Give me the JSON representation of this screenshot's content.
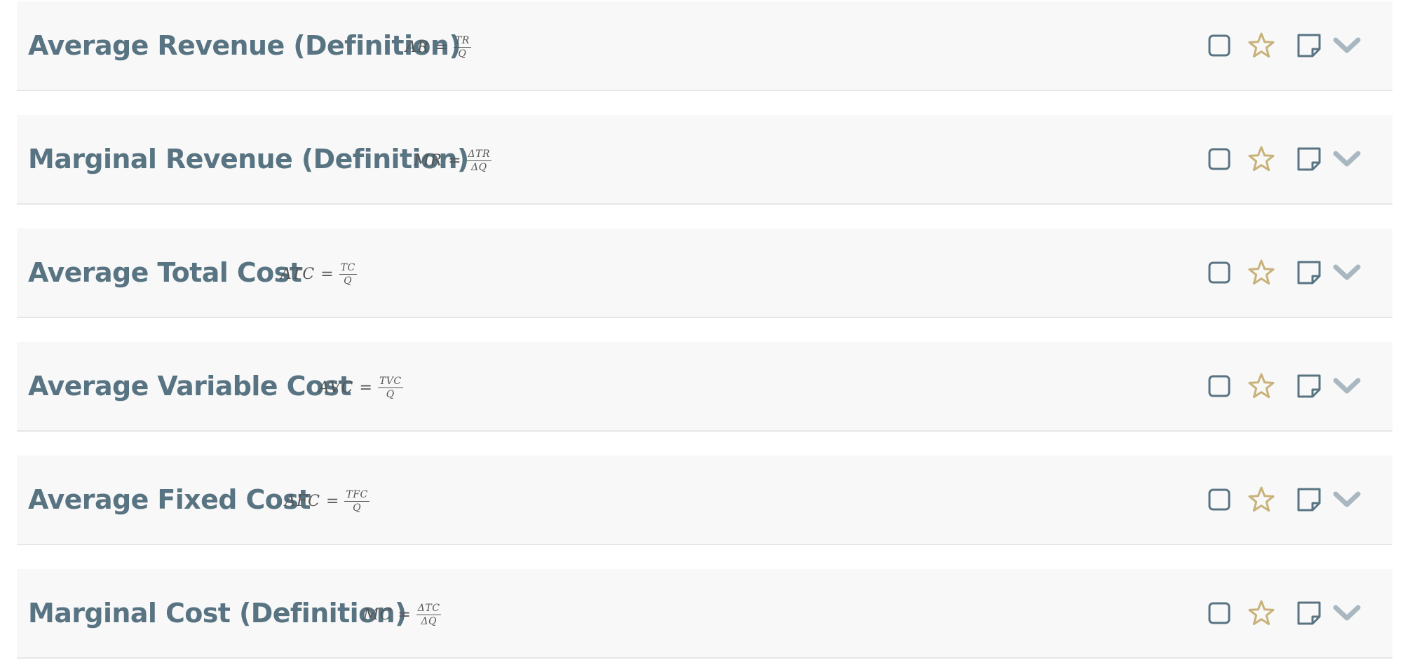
{
  "colors": {
    "row_background": "#f8f8f8",
    "title": "#587482",
    "formula": "#555555",
    "icon_outline": "#587482",
    "star": "#c8b27a",
    "chevron": "#a9b8c0"
  },
  "icons": {
    "checkbox": "checkbox-icon",
    "favorite": "star-icon",
    "note": "note-icon",
    "expand": "chevron-down-icon"
  },
  "items": [
    {
      "title": "Average Revenue (Definition)",
      "formula": {
        "lhs": "AR",
        "eq": "=",
        "num": "TR",
        "den": "Q"
      }
    },
    {
      "title": "Marginal Revenue (Definition)",
      "formula": {
        "lhs": "MR",
        "eq": "=",
        "num": "ΔTR",
        "den": "ΔQ"
      }
    },
    {
      "title": "Average Total Cost",
      "formula": {
        "lhs": "ATC",
        "eq": "=",
        "num": "TC",
        "den": "Q"
      }
    },
    {
      "title": "Average Variable Cost",
      "formula": {
        "lhs": "AVC",
        "eq": "=",
        "num": "TVC",
        "den": "Q"
      }
    },
    {
      "title": "Average Fixed Cost",
      "formula": {
        "lhs": "AFC",
        "eq": "=",
        "num": "TFC",
        "den": "Q"
      }
    },
    {
      "title": "Marginal Cost (Definition)",
      "formula": {
        "lhs": "MC",
        "eq": "=",
        "num": "ΔTC",
        "den": "ΔQ"
      }
    }
  ]
}
